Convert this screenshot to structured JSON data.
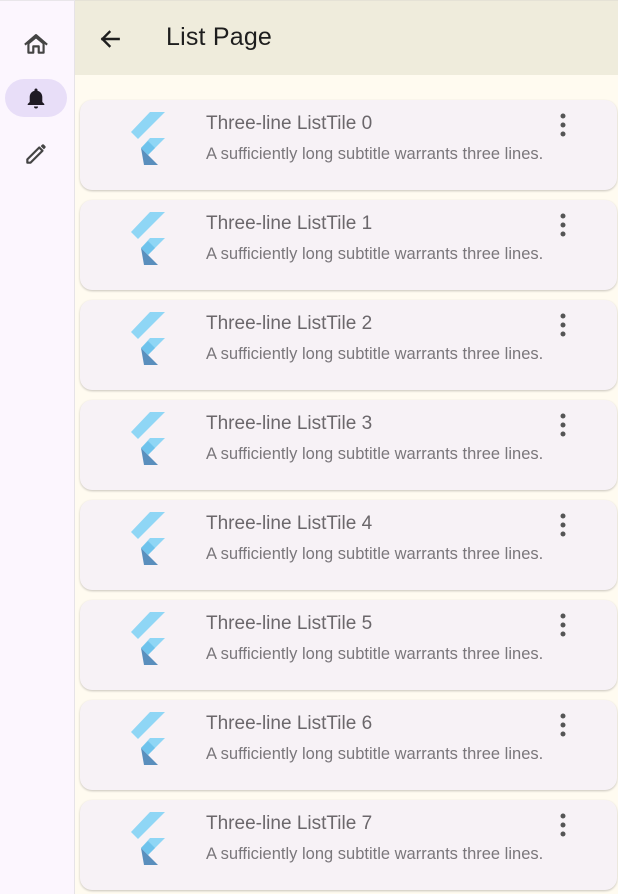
{
  "rail": {
    "items": [
      {
        "icon": "home-icon",
        "label": "home"
      },
      {
        "icon": "bell-icon",
        "label": "notifications",
        "selected": true
      },
      {
        "icon": "pencil-icon",
        "label": "edit"
      }
    ],
    "selected_color": "#e8def8"
  },
  "appbar": {
    "title": "List Page",
    "back_icon": "arrow-left-icon",
    "background": "#efecdc"
  },
  "list": {
    "items": [
      {
        "title": "Three-line ListTile 0",
        "subtitle": "A sufficiently long subtitle warrants three lines.",
        "leading_icon": "flutter-logo-icon",
        "trailing_icon": "more-vert-icon"
      },
      {
        "title": "Three-line ListTile 1",
        "subtitle": "A sufficiently long subtitle warrants three lines.",
        "leading_icon": "flutter-logo-icon",
        "trailing_icon": "more-vert-icon"
      },
      {
        "title": "Three-line ListTile 2",
        "subtitle": "A sufficiently long subtitle warrants three lines.",
        "leading_icon": "flutter-logo-icon",
        "trailing_icon": "more-vert-icon"
      },
      {
        "title": "Three-line ListTile 3",
        "subtitle": "A sufficiently long subtitle warrants three lines.",
        "leading_icon": "flutter-logo-icon",
        "trailing_icon": "more-vert-icon"
      },
      {
        "title": "Three-line ListTile 4",
        "subtitle": "A sufficiently long subtitle warrants three lines.",
        "leading_icon": "flutter-logo-icon",
        "trailing_icon": "more-vert-icon"
      },
      {
        "title": "Three-line ListTile 5",
        "subtitle": "A sufficiently long subtitle warrants three lines.",
        "leading_icon": "flutter-logo-icon",
        "trailing_icon": "more-vert-icon"
      },
      {
        "title": "Three-line ListTile 6",
        "subtitle": "A sufficiently long subtitle warrants three lines.",
        "leading_icon": "flutter-logo-icon",
        "trailing_icon": "more-vert-icon"
      },
      {
        "title": "Three-line ListTile 7",
        "subtitle": "A sufficiently long subtitle warrants three lines.",
        "leading_icon": "flutter-logo-icon",
        "trailing_icon": "more-vert-icon"
      }
    ]
  }
}
